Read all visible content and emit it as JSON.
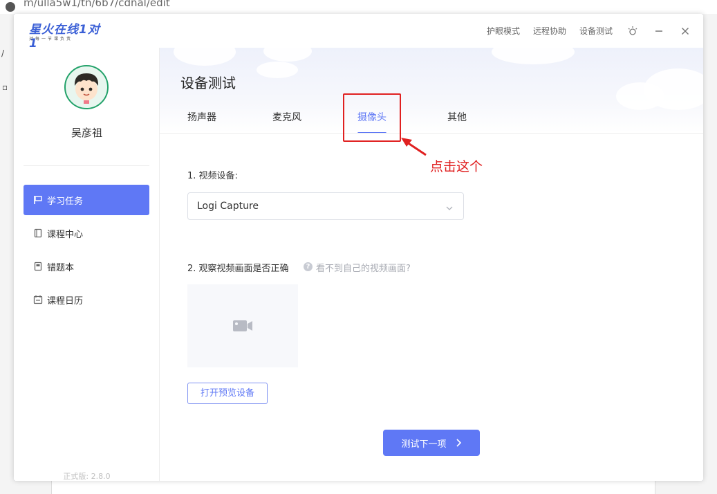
{
  "background": {
    "url_text": "m/ulla5w1/tn/6b7/cdnal/edit"
  },
  "app": {
    "logo": {
      "brand": "星火在线1对1",
      "slogan": "对每一节课负责"
    },
    "titlebar": {
      "links": [
        "护眼模式",
        "远程协助",
        "设备测试"
      ]
    },
    "user": {
      "name": "吴彦祖"
    },
    "sidebar": {
      "items": [
        {
          "label": "学习任务",
          "icon": "flag-icon",
          "active": true
        },
        {
          "label": "课程中心",
          "icon": "book-icon",
          "active": false
        },
        {
          "label": "错题本",
          "icon": "notebook-icon",
          "active": false
        },
        {
          "label": "课程日历",
          "icon": "calendar-icon",
          "active": false
        }
      ],
      "version": "正式版: 2.8.0"
    },
    "main": {
      "title": "设备测试",
      "tabs": [
        {
          "label": "扬声器",
          "active": false
        },
        {
          "label": "麦克风",
          "active": false
        },
        {
          "label": "摄像头",
          "active": true
        },
        {
          "label": "其他",
          "active": false
        }
      ],
      "video_device_label": "1. 视频设备:",
      "video_device_value": "Logi Capture",
      "observe_label": "2. 观察视频画面是否正确",
      "help_text": "看不到自己的视频画面?",
      "preview_button": "打开预览设备",
      "next_button": "测试下一项"
    }
  },
  "annotation": {
    "text": "点击这个"
  },
  "colors": {
    "accent": "#5f78f5",
    "annotation_red": "#e02020",
    "brand_blue": "#3a5fd6"
  }
}
